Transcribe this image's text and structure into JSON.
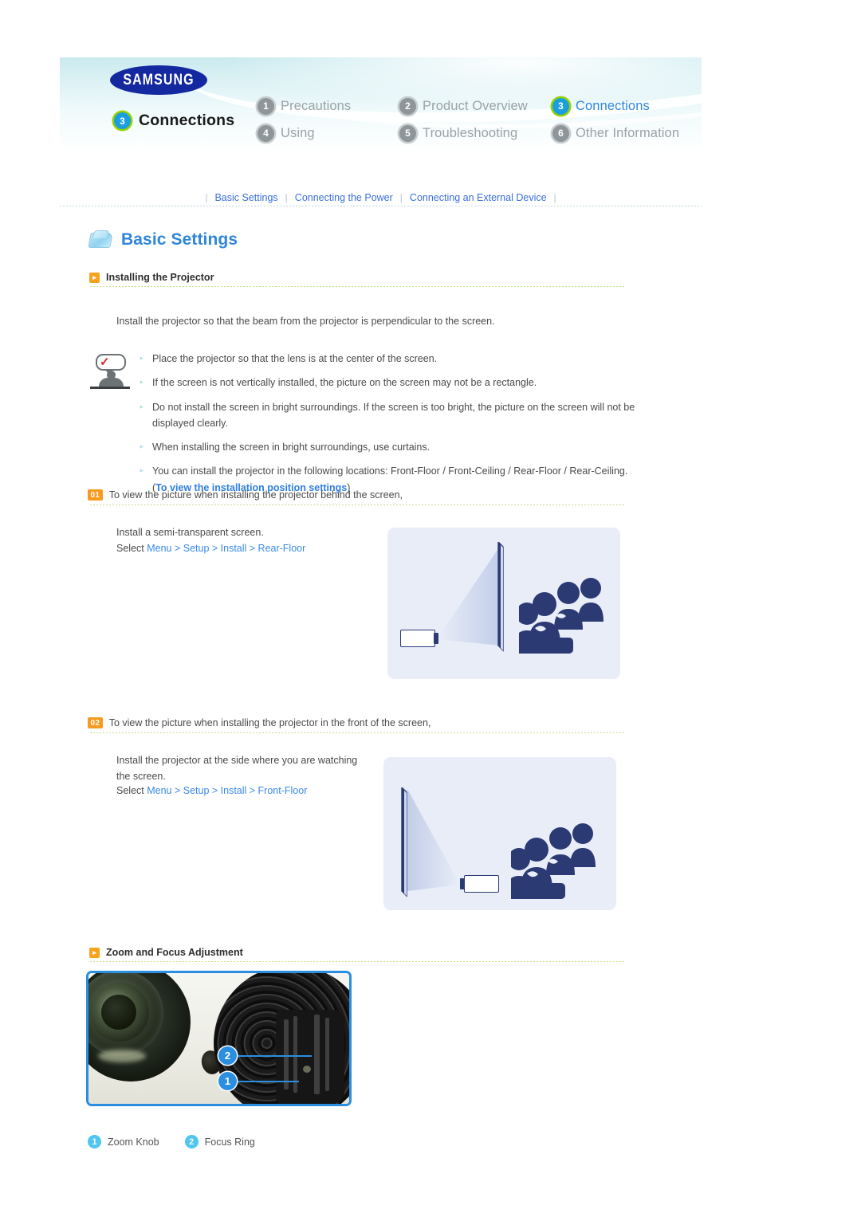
{
  "brand": {
    "logo_text": "SAMSUNG"
  },
  "header": {
    "chapter_number": "3",
    "chapter_title": "Connections",
    "nav": [
      {
        "num": "1",
        "label": "Precautions",
        "active": false
      },
      {
        "num": "2",
        "label": "Product Overview",
        "active": false
      },
      {
        "num": "3",
        "label": "Connections",
        "active": true
      },
      {
        "num": "4",
        "label": "Using",
        "active": false
      },
      {
        "num": "5",
        "label": "Troubleshooting",
        "active": false
      },
      {
        "num": "6",
        "label": "Other Information",
        "active": false
      }
    ]
  },
  "breadcrumbs": [
    "Basic Settings",
    "Connecting the Power",
    "Connecting an External Device"
  ],
  "section": {
    "folder_title": "Basic Settings",
    "sub_title": "Installing the Projector",
    "intro": "Install the projector so that the beam from the projector is perpendicular to the screen.",
    "notes": [
      "Place the projector so that the lens is at the center of the screen.",
      "If the screen is not vertically installed, the picture on the screen may not be a rectangle.",
      "Do not install the screen in bright surroundings. If the screen is too bright, the picture on the screen will not be displayed clearly.",
      "When installing the screen in bright surroundings, use curtains.",
      "You can install the projector in the following locations: Front-Floor / Front-Ceiling / Rear-Floor / Rear-Ceiling."
    ],
    "note_link_open": "(",
    "note_link": "To view the installation position settings",
    "note_link_close": ")"
  },
  "steps": [
    {
      "num": "01",
      "heading": "To view the picture when installing the projector behind the screen,",
      "line1": "Install a semi-transparent screen.",
      "select_prefix": "Select ",
      "select_path": "Menu > Setup > Install > Rear-Floor",
      "illustration": "rear-projection-diagram"
    },
    {
      "num": "02",
      "heading": "To view the picture when installing the projector in the front of the screen,",
      "line1": "Install the projector at the side where you are watching",
      "line2": "the screen.",
      "select_prefix": "Select ",
      "select_path": "Menu > Setup > Install > Front-Floor",
      "illustration": "front-projection-diagram"
    }
  ],
  "zoom_focus": {
    "sub_title": "Zoom and Focus Adjustment",
    "photo_alt": "projector-lens-photo",
    "callouts": [
      {
        "num": "2",
        "name": "Focus Ring"
      },
      {
        "num": "1",
        "name": "Zoom Knob"
      }
    ],
    "legend": [
      {
        "num": "1",
        "label": "Zoom Knob"
      },
      {
        "num": "2",
        "label": "Focus Ring"
      }
    ]
  },
  "colors": {
    "accent_blue": "#2e86de",
    "link_blue": "#3a6fe0",
    "active_ring_green": "#96d300",
    "orange": "#f79a1e",
    "samsung_blue": "#1428a0",
    "divider_green": "#c5e08c",
    "illustration_bg": "#e8edf8",
    "illustration_navy": "#2c3a74"
  }
}
